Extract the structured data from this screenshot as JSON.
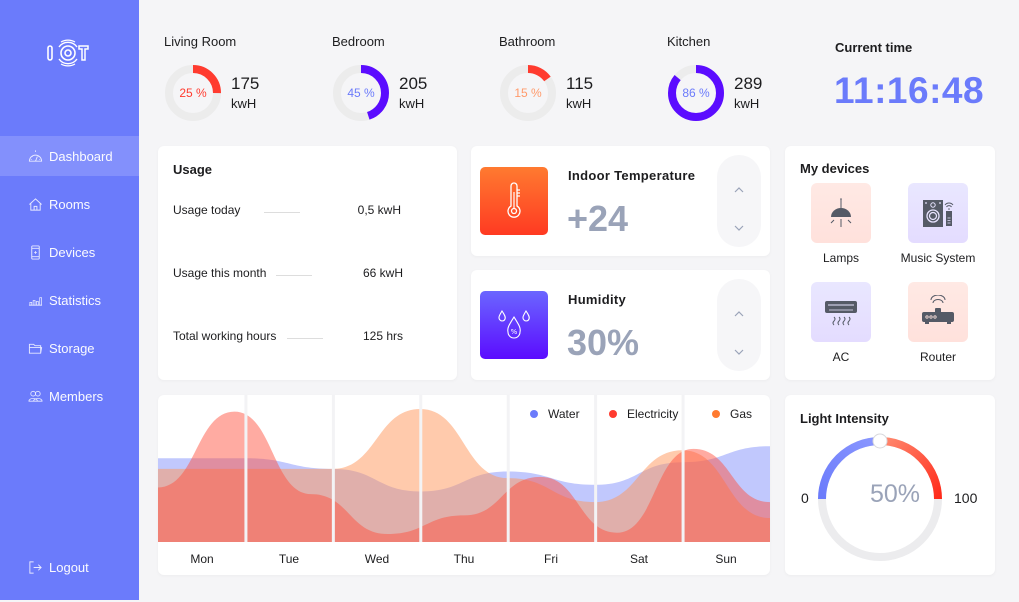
{
  "app": {
    "logo_text": "IOT"
  },
  "sidebar": {
    "items": [
      {
        "label": "Dashboard",
        "icon": "dashboard-gauge-icon",
        "active": true
      },
      {
        "label": "Rooms",
        "icon": "home-icon",
        "active": false
      },
      {
        "label": "Devices",
        "icon": "phone-device-icon",
        "active": false
      },
      {
        "label": "Statistics",
        "icon": "bar-stats-icon",
        "active": false
      },
      {
        "label": "Storage",
        "icon": "folder-icon",
        "active": false
      },
      {
        "label": "Members",
        "icon": "members-icon",
        "active": false
      }
    ],
    "logout_label": "Logout"
  },
  "rooms": [
    {
      "name": "Living Room",
      "percent": 25,
      "percent_label": "25 %",
      "value": "175",
      "unit": "kwH",
      "color": "#ff3b2f",
      "text_color": "#ff3b2f"
    },
    {
      "name": "Bedroom",
      "percent": 45,
      "percent_label": "45 %",
      "value": "205",
      "unit": "kwH",
      "color": "#5b0cff",
      "text_color": "#6b7bfb"
    },
    {
      "name": "Bathroom",
      "percent": 15,
      "percent_label": "15 %",
      "value": "115",
      "unit": "kwH",
      "color": "#ff3b2f",
      "text_color": "#ff9a6b"
    },
    {
      "name": "Kitchen",
      "percent": 86,
      "percent_label": "86 %",
      "value": "289",
      "unit": "kwH",
      "color": "#5b0cff",
      "text_color": "#6b7bfb"
    }
  ],
  "clock": {
    "label": "Current time",
    "value": "11:16:48"
  },
  "usage": {
    "title": "Usage",
    "rows": [
      {
        "label": "Usage today",
        "value": "0,5 kwH"
      },
      {
        "label": "Usage this month",
        "value": "66 kwH"
      },
      {
        "label": "Total working hours",
        "value": "125 hrs"
      }
    ]
  },
  "temperature": {
    "title": "Indoor Temperature",
    "value": "+24"
  },
  "humidity": {
    "title": "Humidity",
    "value": "30%"
  },
  "devices": {
    "title": "My devices",
    "items": [
      {
        "label": "Lamps",
        "icon": "lamp-icon"
      },
      {
        "label": "Music System",
        "icon": "speaker-icon"
      },
      {
        "label": "AC",
        "icon": "air-conditioner-icon"
      },
      {
        "label": "Router",
        "icon": "router-icon"
      }
    ]
  },
  "light": {
    "title": "Light Intensity",
    "min_label": "0",
    "max_label": "100",
    "value": 50,
    "value_label": "50%"
  },
  "chart_data": {
    "type": "area",
    "title": "",
    "xlabel": "",
    "ylabel": "",
    "categories": [
      "Mon",
      "Tue",
      "Wed",
      "Thu",
      "Fri",
      "Sat",
      "Sun"
    ],
    "ylim": [
      0,
      100
    ],
    "grid": false,
    "legend_position": "top-right",
    "series": [
      {
        "name": "Water",
        "color": "#6b7bfb",
        "values": [
          63,
          63,
          55,
          38,
          53,
          43,
          60,
          72
        ]
      },
      {
        "name": "Electricity",
        "color": "#ff3b2f",
        "values": [
          41,
          98,
          36,
          6,
          20,
          49,
          7,
          70,
          30
        ]
      },
      {
        "name": "Gas",
        "color": "#ff7a30",
        "values": [
          55,
          55,
          55,
          100,
          48,
          30,
          69,
          18
        ]
      }
    ]
  }
}
